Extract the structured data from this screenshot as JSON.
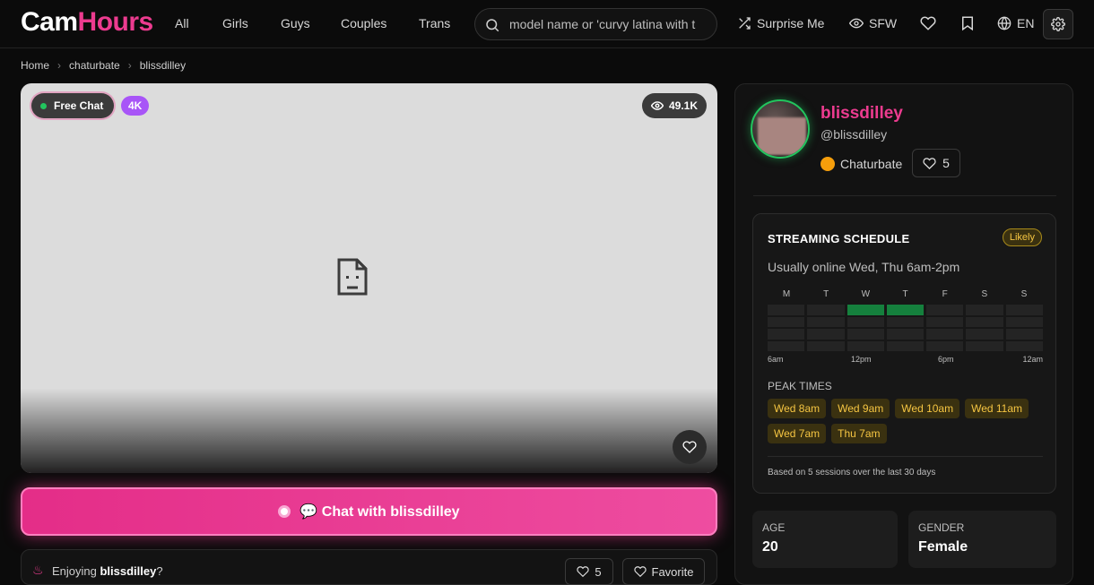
{
  "header": {
    "logo_a": "Cam",
    "logo_b": "Hours",
    "nav": [
      "All",
      "Girls",
      "Guys",
      "Couples",
      "Trans"
    ],
    "search_placeholder": "model name or 'curvy latina with t",
    "surprise_label": "Surprise Me",
    "sfw_label": "SFW",
    "lang_label": "EN",
    "brand_color": "#ec3b8f"
  },
  "breadcrumb": [
    "Home",
    "chaturbate",
    "blissdilley"
  ],
  "video": {
    "status_label": "Free Chat",
    "quality_label": "4K",
    "viewers": "49.1K"
  },
  "chat_button": "💬 Chat with blissdilley",
  "enjoy": {
    "prefix": "Enjoying ",
    "name": "blissdilley",
    "suffix": "?",
    "like_count": "5",
    "favorite_label": "Favorite"
  },
  "profile": {
    "display_name": "blissdilley",
    "handle": "@blissdilley",
    "platform": "Chaturbate",
    "likes": "5"
  },
  "schedule": {
    "title": "STREAMING SCHEDULE",
    "badge": "Likely",
    "summary": "Usually online Wed, Thu 6am-2pm",
    "days": [
      "M",
      "T",
      "W",
      "T",
      "F",
      "S",
      "S"
    ],
    "active": [
      [
        0,
        0,
        0,
        0
      ],
      [
        0,
        0,
        0,
        0
      ],
      [
        1,
        0,
        0,
        0
      ],
      [
        1,
        0,
        0,
        0
      ],
      [
        0,
        0,
        0,
        0
      ],
      [
        0,
        0,
        0,
        0
      ],
      [
        0,
        0,
        0,
        0
      ]
    ],
    "hours": [
      "6am",
      "12pm",
      "6pm",
      "12am"
    ],
    "peak_heading": "PEAK TIMES",
    "peak_times": [
      "Wed 8am",
      "Wed 9am",
      "Wed 10am",
      "Wed 11am",
      "Wed 7am",
      "Thu 7am"
    ],
    "footnote": "Based on 5 sessions over the last 30 days"
  },
  "stats": {
    "age_label": "AGE",
    "age_value": "20",
    "gender_label": "GENDER",
    "gender_value": "Female"
  }
}
